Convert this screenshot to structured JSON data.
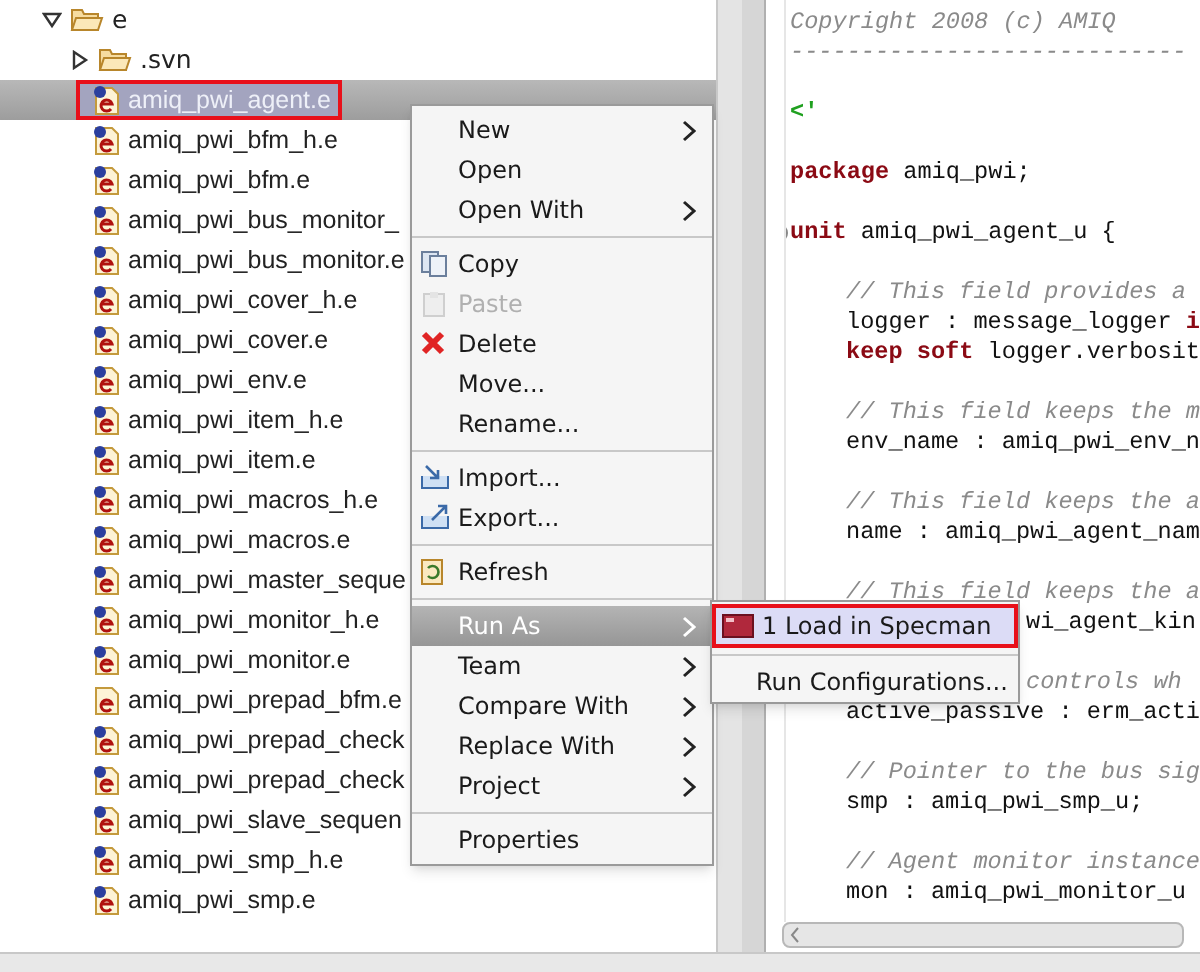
{
  "tree": {
    "root": {
      "label": "e",
      "expanded": true
    },
    "folder": {
      "label": ".svn",
      "expanded": false
    },
    "files": [
      {
        "label": "amiq_pwi_agent.e",
        "selected": true,
        "marked": true,
        "versioned": true
      },
      {
        "label": "amiq_pwi_bfm_h.e",
        "selected": false,
        "marked": false,
        "versioned": true
      },
      {
        "label": "amiq_pwi_bfm.e",
        "selected": false,
        "marked": false,
        "versioned": true
      },
      {
        "label": "amiq_pwi_bus_monitor_",
        "selected": false,
        "marked": false,
        "versioned": true
      },
      {
        "label": "amiq_pwi_bus_monitor.e",
        "selected": false,
        "marked": false,
        "versioned": true
      },
      {
        "label": "amiq_pwi_cover_h.e",
        "selected": false,
        "marked": false,
        "versioned": true
      },
      {
        "label": "amiq_pwi_cover.e",
        "selected": false,
        "marked": false,
        "versioned": true
      },
      {
        "label": "amiq_pwi_env.e",
        "selected": false,
        "marked": false,
        "versioned": true
      },
      {
        "label": "amiq_pwi_item_h.e",
        "selected": false,
        "marked": false,
        "versioned": true
      },
      {
        "label": "amiq_pwi_item.e",
        "selected": false,
        "marked": false,
        "versioned": true
      },
      {
        "label": "amiq_pwi_macros_h.e",
        "selected": false,
        "marked": false,
        "versioned": true
      },
      {
        "label": "amiq_pwi_macros.e",
        "selected": false,
        "marked": false,
        "versioned": true
      },
      {
        "label": "amiq_pwi_master_seque",
        "selected": false,
        "marked": false,
        "versioned": true
      },
      {
        "label": "amiq_pwi_monitor_h.e",
        "selected": false,
        "marked": false,
        "versioned": true
      },
      {
        "label": "amiq_pwi_monitor.e",
        "selected": false,
        "marked": false,
        "versioned": true
      },
      {
        "label": "amiq_pwi_prepad_bfm.e",
        "selected": false,
        "marked": false,
        "versioned": false
      },
      {
        "label": "amiq_pwi_prepad_check",
        "selected": false,
        "marked": false,
        "versioned": true
      },
      {
        "label": "amiq_pwi_prepad_check",
        "selected": false,
        "marked": false,
        "versioned": true
      },
      {
        "label": "amiq_pwi_slave_sequen",
        "selected": false,
        "marked": false,
        "versioned": true
      },
      {
        "label": "amiq_pwi_smp_h.e",
        "selected": false,
        "marked": false,
        "versioned": true
      },
      {
        "label": "amiq_pwi_smp.e",
        "selected": false,
        "marked": false,
        "versioned": true
      }
    ]
  },
  "context_menu": [
    {
      "kind": "plain",
      "label": "New",
      "submenu": true,
      "disabled": false,
      "selected": false
    },
    {
      "kind": "plain",
      "label": "Open",
      "submenu": false,
      "disabled": false,
      "selected": false
    },
    {
      "kind": "plain",
      "label": "Open With",
      "submenu": true,
      "disabled": false,
      "selected": false
    },
    {
      "kind": "separator"
    },
    {
      "kind": "copy",
      "label": "Copy",
      "submenu": false,
      "disabled": false,
      "selected": false
    },
    {
      "kind": "paste",
      "label": "Paste",
      "submenu": false,
      "disabled": true,
      "selected": false
    },
    {
      "kind": "delete",
      "label": "Delete",
      "submenu": false,
      "disabled": false,
      "selected": false
    },
    {
      "kind": "plain",
      "label": "Move...",
      "submenu": false,
      "disabled": false,
      "selected": false
    },
    {
      "kind": "plain",
      "label": "Rename...",
      "submenu": false,
      "disabled": false,
      "selected": false
    },
    {
      "kind": "separator"
    },
    {
      "kind": "import",
      "label": "Import...",
      "submenu": false,
      "disabled": false,
      "selected": false
    },
    {
      "kind": "export",
      "label": "Export...",
      "submenu": false,
      "disabled": false,
      "selected": false
    },
    {
      "kind": "separator"
    },
    {
      "kind": "refresh",
      "label": "Refresh",
      "submenu": false,
      "disabled": false,
      "selected": false
    },
    {
      "kind": "separator"
    },
    {
      "kind": "plain",
      "label": "Run As",
      "submenu": true,
      "disabled": false,
      "selected": true
    },
    {
      "kind": "plain",
      "label": "Team",
      "submenu": true,
      "disabled": false,
      "selected": false
    },
    {
      "kind": "plain",
      "label": "Compare With",
      "submenu": true,
      "disabled": false,
      "selected": false
    },
    {
      "kind": "plain",
      "label": "Replace With",
      "submenu": true,
      "disabled": false,
      "selected": false
    },
    {
      "kind": "plain",
      "label": "Project",
      "submenu": true,
      "disabled": false,
      "selected": false
    },
    {
      "kind": "separator"
    },
    {
      "kind": "plain",
      "label": "Properties",
      "submenu": false,
      "disabled": false,
      "selected": false
    }
  ],
  "submenu": [
    {
      "kind": "launch",
      "label": "1 Load in Specman",
      "selected": true,
      "marked": true
    },
    {
      "kind": "separator"
    },
    {
      "kind": "plain",
      "label": "Run Configurations...",
      "selected": false,
      "marked": false
    }
  ],
  "editor": {
    "lines": [
      {
        "kind": "code",
        "tokens": [
          {
            "kind": "comment",
            "text": "Copyright 2008 (c) AMIQ"
          }
        ]
      },
      {
        "kind": "code",
        "tokens": [
          {
            "kind": "comment",
            "text": "----------------------------"
          }
        ]
      },
      {
        "kind": "blank"
      },
      {
        "kind": "code",
        "tokens": [
          {
            "kind": "delimiter",
            "text": "<'"
          }
        ]
      },
      {
        "kind": "blank"
      },
      {
        "kind": "code",
        "tokens": [
          {
            "kind": "keyword",
            "text": "package"
          },
          {
            "kind": "plain",
            "text": " amiq_pwi;"
          }
        ]
      },
      {
        "kind": "blank"
      },
      {
        "kind": "fold",
        "tokens": [
          {
            "kind": "keyword",
            "text": "unit"
          },
          {
            "kind": "plain",
            "text": " amiq_pwi_agent_u {"
          }
        ]
      },
      {
        "kind": "blank"
      },
      {
        "kind": "indented",
        "tokens": [
          {
            "kind": "comment",
            "text": "// This field provides a"
          }
        ]
      },
      {
        "kind": "indented",
        "tokens": [
          {
            "kind": "plain",
            "text": "logger : message_logger "
          },
          {
            "kind": "keyword",
            "text": "i"
          }
        ]
      },
      {
        "kind": "indented",
        "tokens": [
          {
            "kind": "keyword",
            "text": "keep soft"
          },
          {
            "kind": "plain",
            "text": " logger.verbosit"
          }
        ]
      },
      {
        "kind": "blank"
      },
      {
        "kind": "indented",
        "tokens": [
          {
            "kind": "comment",
            "text": "// This field keeps the m"
          }
        ]
      },
      {
        "kind": "indented",
        "tokens": [
          {
            "kind": "plain",
            "text": "env_name : amiq_pwi_env_n"
          }
        ]
      },
      {
        "kind": "blank"
      },
      {
        "kind": "indented",
        "tokens": [
          {
            "kind": "comment",
            "text": "// This field keeps the a"
          }
        ]
      },
      {
        "kind": "indented",
        "tokens": [
          {
            "kind": "plain",
            "text": "name : amiq_pwi_agent_nam"
          }
        ]
      },
      {
        "kind": "blank"
      },
      {
        "kind": "indented",
        "tokens": [
          {
            "kind": "comment",
            "text": "// This field keeps the a"
          }
        ]
      },
      {
        "kind": "covered",
        "tokens": [
          {
            "kind": "plain",
            "text": "wi_agent_kin"
          }
        ]
      },
      {
        "kind": "blank"
      },
      {
        "kind": "covered",
        "tokens": [
          {
            "kind": "comment",
            "text": "controls wh"
          }
        ]
      },
      {
        "kind": "indented",
        "tokens": [
          {
            "kind": "plain",
            "text": "active_passive : erm_acti"
          }
        ]
      },
      {
        "kind": "blank"
      },
      {
        "kind": "indented",
        "tokens": [
          {
            "kind": "comment",
            "text": "// Pointer to the bus sig"
          }
        ]
      },
      {
        "kind": "indented",
        "tokens": [
          {
            "kind": "plain",
            "text": "smp : amiq_pwi_smp_u;"
          }
        ]
      },
      {
        "kind": "blank"
      },
      {
        "kind": "indented",
        "tokens": [
          {
            "kind": "comment",
            "text": "// Agent monitor instance"
          }
        ]
      },
      {
        "kind": "indented",
        "tokens": [
          {
            "kind": "plain",
            "text": "mon : amiq_pwi_monitor_u"
          }
        ]
      }
    ]
  }
}
